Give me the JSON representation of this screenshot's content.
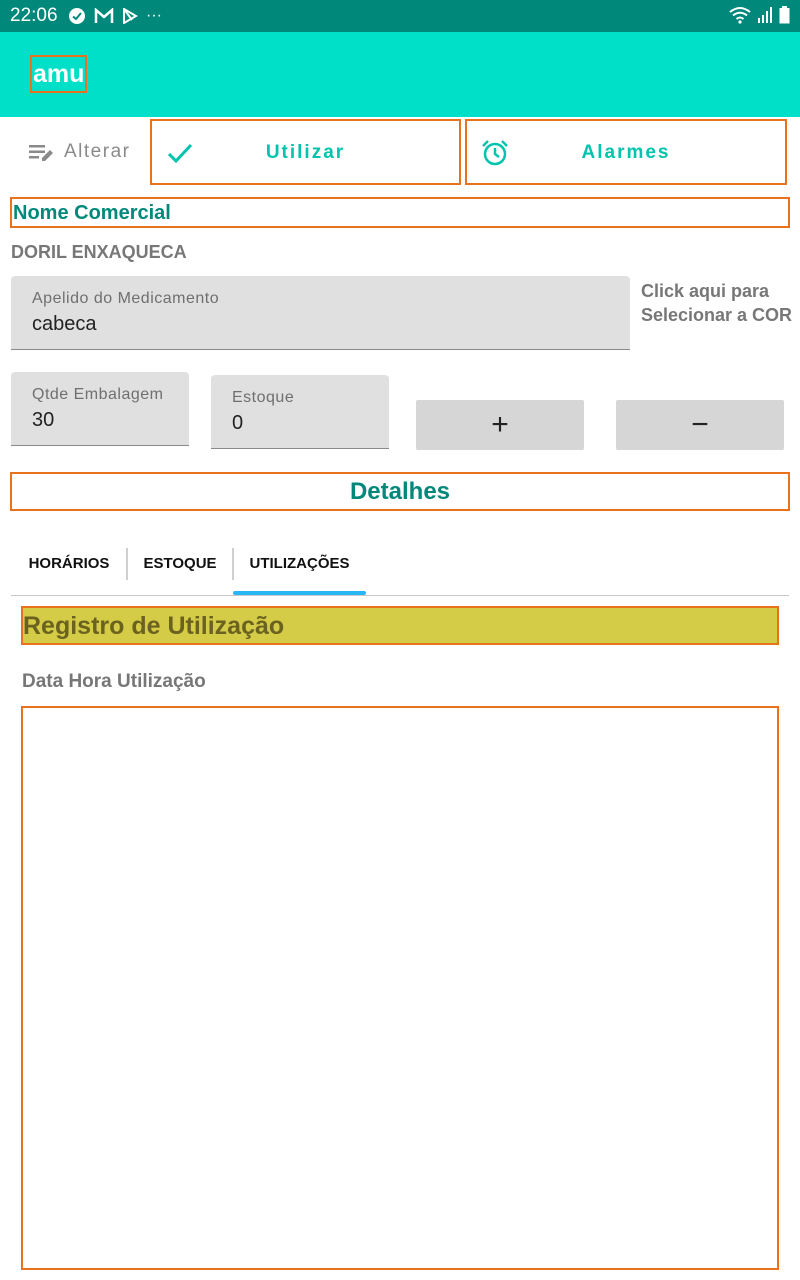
{
  "status_bar": {
    "time": "22:06",
    "left_icons": [
      "check-circle-icon",
      "gmail-icon",
      "play-store-icon",
      "more-dots-icon"
    ],
    "right_icons": [
      "wifi-icon",
      "signal-icon",
      "battery-icon"
    ],
    "more_label": "···"
  },
  "app_bar": {
    "title": "amu",
    "color": "#00dfc8"
  },
  "actions": {
    "alterar": "Alterar",
    "utilizar": "Utilizar",
    "alarmes": "Alarmes"
  },
  "nome_comercial": {
    "label": "Nome Comercial",
    "value": "DORIL ENXAQUECA"
  },
  "fields": {
    "apelido": {
      "label": "Apelido do Medicamento",
      "value": "cabeca"
    },
    "qtde": {
      "label": "Qtde Embalagem",
      "value": "30"
    },
    "estoque": {
      "label": "Estoque",
      "value": "0"
    }
  },
  "cor_hint": {
    "line1": "Click aqui para",
    "line2": "Selecionar a COR"
  },
  "steppers": {
    "plus": "+",
    "minus": "−"
  },
  "detalhes": "Detalhes",
  "tabs": [
    {
      "label": "HORÁRIOS"
    },
    {
      "label": "ESTOQUE"
    },
    {
      "label": "UTILIZAÇÕES",
      "selected": true
    }
  ],
  "registro": {
    "title": "Registro de Utilização",
    "subtitle": "Data Hora Utilização",
    "items": []
  },
  "colors": {
    "accent": "#00dfc8",
    "teal_dark": "#00897b",
    "outline": "#e8731c",
    "highlight": "#d4cc47",
    "tab_indicator": "#29b6f6"
  }
}
